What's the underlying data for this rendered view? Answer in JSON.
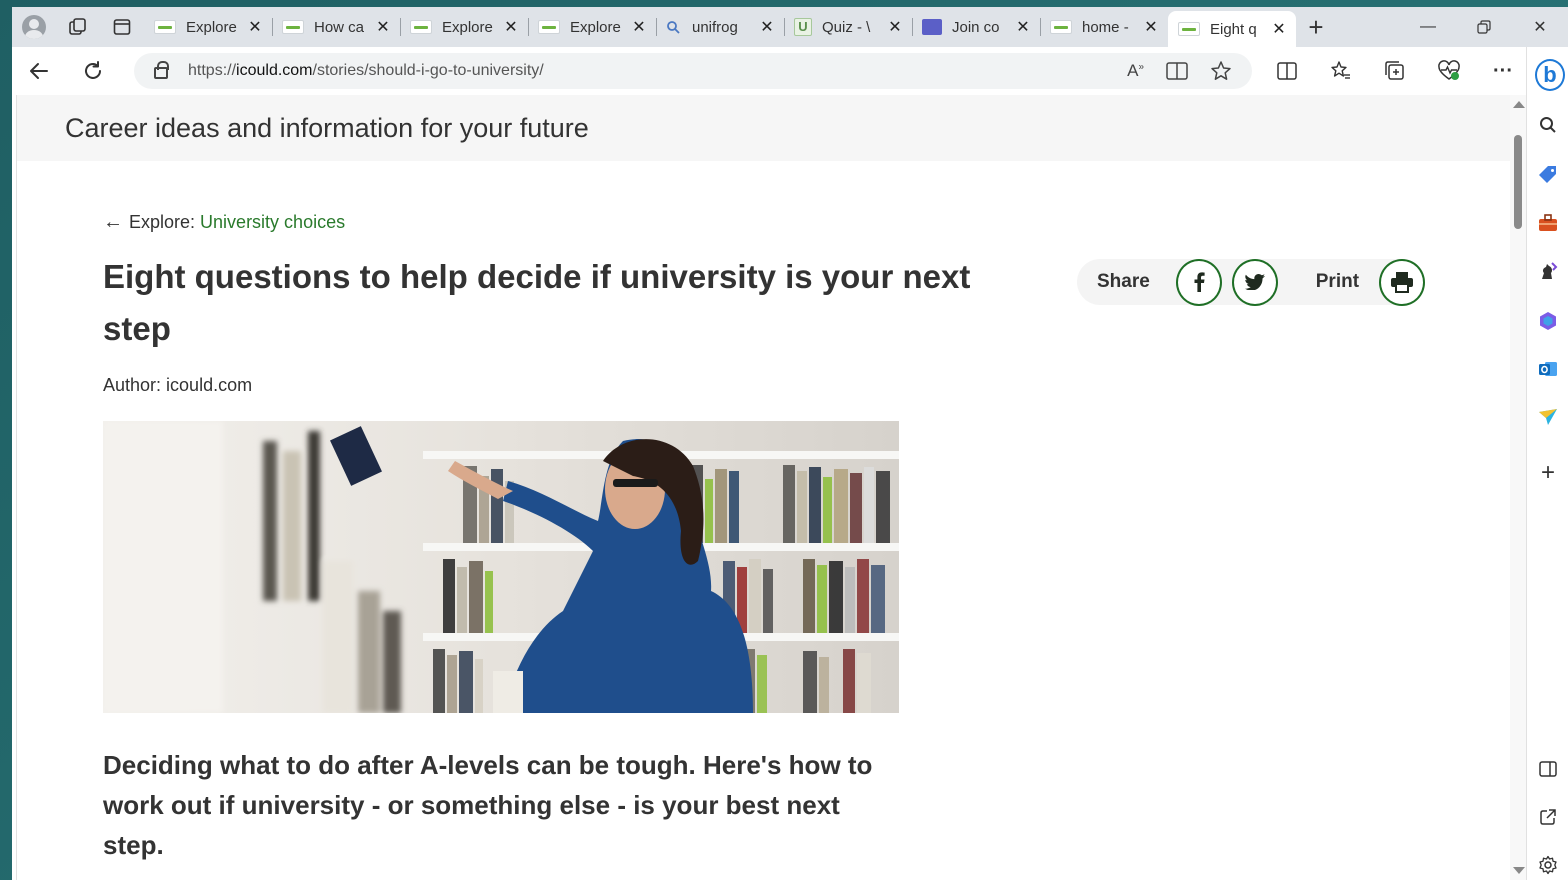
{
  "browser": {
    "tabs": [
      {
        "title": "Explore",
        "favicon": "icould-favicon",
        "active": false
      },
      {
        "title": "How ca",
        "favicon": "icould-favicon",
        "active": false
      },
      {
        "title": "Explore",
        "favicon": "icould-favicon",
        "active": false
      },
      {
        "title": "Explore",
        "favicon": "icould-favicon",
        "active": false
      },
      {
        "title": "unifrog",
        "favicon": "search-icon",
        "active": false
      },
      {
        "title": "Quiz - \\",
        "favicon": "quiz-favicon",
        "active": false
      },
      {
        "title": "Join co",
        "favicon": "teams-icon",
        "active": false
      },
      {
        "title": "home -",
        "favicon": "icould-favicon",
        "active": false
      },
      {
        "title": "Eight q",
        "favicon": "icould-favicon",
        "active": true
      }
    ],
    "url_prefix": "https://",
    "url_host": "icould.com",
    "url_path": "/stories/should-i-go-to-university/"
  },
  "page": {
    "header_title": "Career ideas and information for your future",
    "breadcrumb_prefix": "Explore:",
    "breadcrumb_link": "University choices",
    "title": "Eight questions to help decide if university is your next step",
    "author_label": "Author:",
    "author_name": "icould.com",
    "lead": "Deciding what to do after A-levels can be tough. Here's how to work out if university - or something else - is your best next step.",
    "share_label": "Share",
    "print_label": "Print"
  },
  "colors": {
    "accent": "#2a7a2c",
    "share_border": "#1f6f26"
  }
}
